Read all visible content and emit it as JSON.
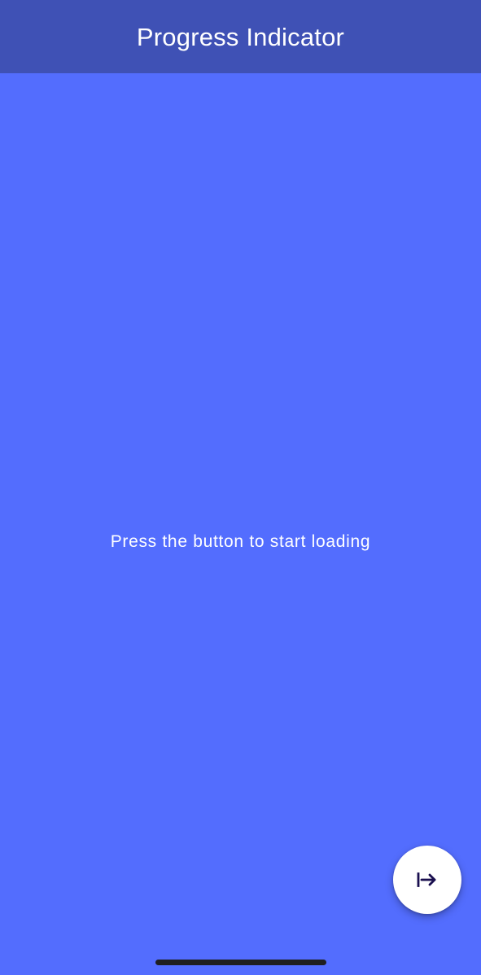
{
  "app_bar": {
    "title": "Progress Indicator",
    "background_color": "#3F51B5",
    "text_color": "#FFFFFF"
  },
  "main": {
    "background_color": "#536DFE",
    "message": "Press the button to start loading"
  },
  "fab": {
    "icon": "arrow-right-to-line-icon",
    "background_color": "#FFFFFF",
    "icon_color": "#1A0F4F"
  },
  "system": {
    "home_indicator_color": "#1F1F1F"
  }
}
